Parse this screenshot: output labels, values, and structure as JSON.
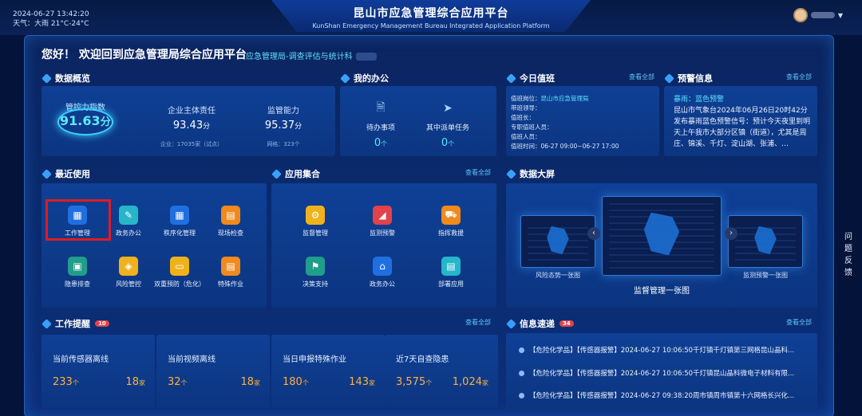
{
  "header": {
    "datetime": "2024-06-27 13:42:20",
    "weather": "天气：大雨 21°C-24°C",
    "title_cn": "昆山市应急管理综合应用平台",
    "title_en": "KunShan Emergency Management Bureau Integrated Application Platform"
  },
  "greeting": "您好！ 欢迎回到应急管理局综合应用平台",
  "department": "应急管理局-调查评估与统计科",
  "sections": {
    "overview": "数据概览",
    "office": "我的办公",
    "duty": "今日值班",
    "warning": "预警信息",
    "recent": "最近使用",
    "apps": "应用集合",
    "bigscreen": "数据大屏",
    "reminders": "工作提醒",
    "news": "信息速递",
    "view_all": "查看全部"
  },
  "overview": {
    "control_label": "管控力指数",
    "control_value": "91.63",
    "control_unit": "分",
    "enterprise_label": "企业主体责任",
    "enterprise_value": "93.43",
    "enterprise_unit": "分",
    "enterprise_sub": "企业：17035家（试点）",
    "supervise_label": "监管能力",
    "supervise_value": "95.37",
    "supervise_unit": "分",
    "supervise_sub": "网格：323个"
  },
  "office": {
    "todo_label": "待办事项",
    "todo_value": "0",
    "todo_unit": "个",
    "task_label": "其中派单任务",
    "task_value": "0",
    "task_unit": "个"
  },
  "duty": {
    "post": "值班岗位：",
    "post_value": "昆山市应急管理局",
    "leader": "带班领导：",
    "chief": "值班长：",
    "liaison": "专职值班人员：",
    "staff": "值班人员：",
    "time": "值班时间：06-27 09:00~06-27 17:00"
  },
  "warning": {
    "type": "暴雨：蓝色预警",
    "text": "昆山市气象台2024年06月26日20时42分发布暴雨蓝色预警信号：预计今天夜里到明天上午我市大部分区镇（街道），尤其是周庄、锦溪、千灯、淀山湖、张浦、…"
  },
  "recent": [
    "工作管理",
    "政务办公",
    "秩序化管理",
    "现场检查",
    "隐患排查",
    "风险管控",
    "双重预防（危化）",
    "特殊作业"
  ],
  "apps": [
    "监督管理",
    "监测预警",
    "指挥救援",
    "决策支持",
    "政务办公",
    "部署应用"
  ],
  "bigscreen": {
    "left": "风险态势一张图",
    "center": "监督管理一张图",
    "right": "监测预警一张图"
  },
  "reminders": {
    "badge": "10",
    "cards": [
      {
        "title": "当前传感器离线",
        "v1": "233",
        "u1": "个",
        "v2": "18",
        "u2": "家"
      },
      {
        "title": "当前视频离线",
        "v1": "32",
        "u1": "个",
        "v2": "18",
        "u2": "家"
      },
      {
        "title": "当日申报特殊作业",
        "v1": "180",
        "u1": "个",
        "v2": "143",
        "u2": "家"
      },
      {
        "title": "近7天自查隐患",
        "v1": "3,575",
        "u1": "个",
        "v2": "1,024",
        "u2": "家"
      }
    ]
  },
  "news": {
    "badge": "34",
    "items": [
      "【危险化学品】【传感器报警】2024-06-27 10:06:50千灯镇千灯镇第三网格昆山晶科...",
      "【危险化学品】【传感器报警】2024-06-27 10:06:50千灯镇昆山晶科微电子材料有限...",
      "【危险化学品】【传感器报警】2024-06-27 09:38:20周市镇周市镇第十六网格长兴化..."
    ]
  },
  "feedback": "问题反馈",
  "colors": {
    "accent": "#5ee0ff",
    "highlight": "#e01c1c",
    "number": "#ffb13b"
  }
}
